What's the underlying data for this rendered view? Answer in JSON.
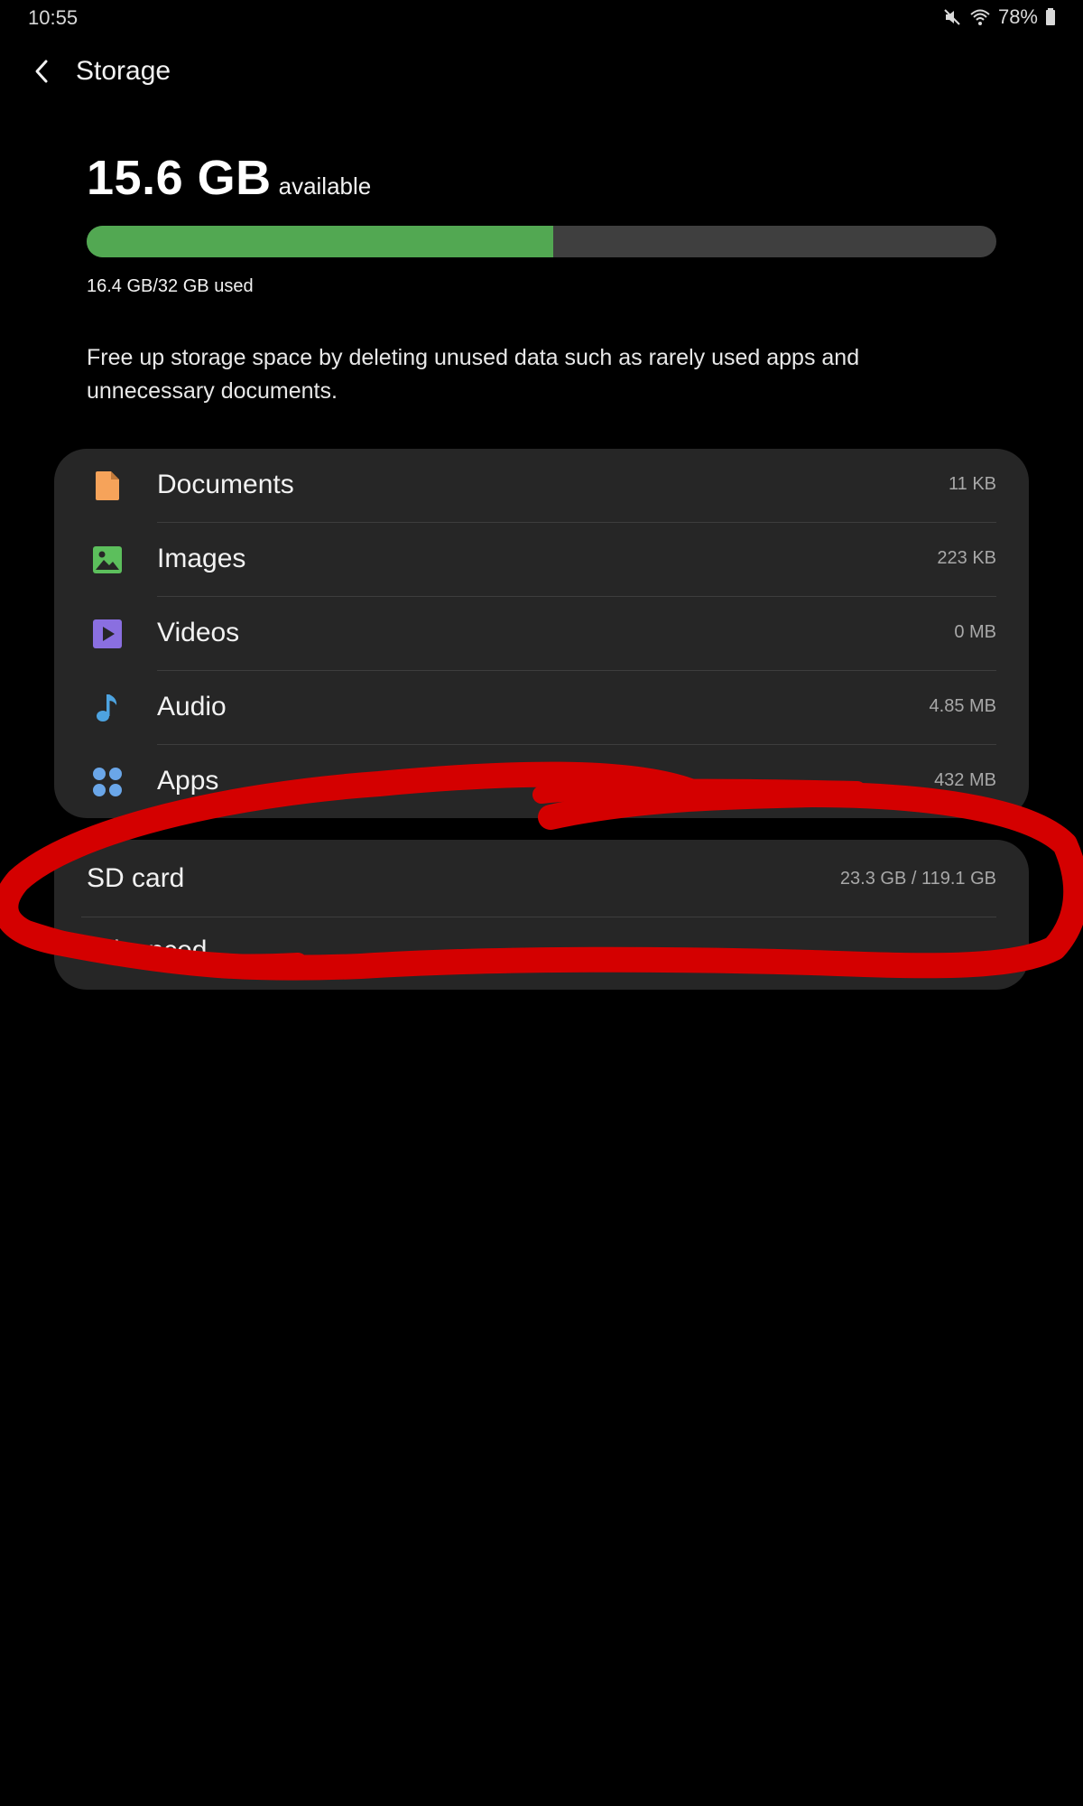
{
  "status_bar": {
    "time": "10:55",
    "battery": "78%",
    "icons": [
      "mute-icon",
      "wifi-icon",
      "battery-icon"
    ]
  },
  "app_bar": {
    "title": "Storage",
    "back_icon": "chevron-left-icon"
  },
  "summary": {
    "available_value": "15.6 GB",
    "available_label": "available",
    "used_text": "16.4 GB/32 GB used",
    "used_fraction": 0.5125,
    "bar_fill_color": "#52a852",
    "bar_track_color": "#3f3f3f",
    "description": "Free up storage space by deleting unused data such as rarely used apps and unnecessary documents."
  },
  "categories": [
    {
      "label": "Documents",
      "size": "11 KB",
      "icon": "document-icon",
      "color": "#f6a35a"
    },
    {
      "label": "Images",
      "size": "223 KB",
      "icon": "image-icon",
      "color": "#5cbf5c"
    },
    {
      "label": "Videos",
      "size": "0 MB",
      "icon": "video-icon",
      "color": "#8a6fe0"
    },
    {
      "label": "Audio",
      "size": "4.85 MB",
      "icon": "music-note-icon",
      "color": "#4da3e0"
    },
    {
      "label": "Apps",
      "size": "432 MB",
      "icon": "apps-grid-icon",
      "color": "#6aa6e8"
    }
  ],
  "sd_card": {
    "label": "SD card",
    "size": "23.3 GB / 119.1 GB"
  },
  "advanced": {
    "label": "Advanced"
  },
  "annotation": {
    "color": "#d40000",
    "description_icon": "red-circle-annotation"
  }
}
